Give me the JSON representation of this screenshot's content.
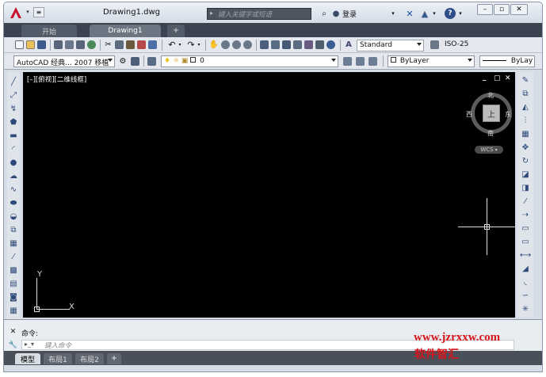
{
  "window": {
    "title": "Drawing1.dwg"
  },
  "search": {
    "placeholder": "键入关键字或短语"
  },
  "login": {
    "label": "登录"
  },
  "tabs": [
    {
      "label": "开始"
    },
    {
      "label": "Drawing1"
    },
    {
      "label": "+"
    }
  ],
  "toolbar": {
    "text_style": "Standard",
    "dim_style": "ISO-25"
  },
  "workspace": {
    "value": "AutoCAD 经典... 2007 移植"
  },
  "layer": {
    "value": "0"
  },
  "properties": {
    "color": "ByLayer",
    "linetype": "ByLay"
  },
  "viewport": {
    "label": "[–][俯视][二维线框]",
    "controls": [
      "_",
      "▢",
      "✕"
    ]
  },
  "viewcube": {
    "north": "北",
    "south": "南",
    "east": "东",
    "west": "西",
    "top": "上",
    "wcs": "WCS"
  },
  "ucs": {
    "x": "X",
    "y": "Y"
  },
  "command": {
    "history": "命令:",
    "prompt": "键入命令"
  },
  "layouts": [
    {
      "label": "模型"
    },
    {
      "label": "布局1"
    },
    {
      "label": "布局2"
    },
    {
      "label": "+"
    }
  ],
  "watermark": {
    "url": "www.jzrxxw.com",
    "name": "软件智汇"
  },
  "colors": {
    "canvas": "#000000",
    "accent": "#c8102e",
    "watermark": "#d7141a"
  }
}
